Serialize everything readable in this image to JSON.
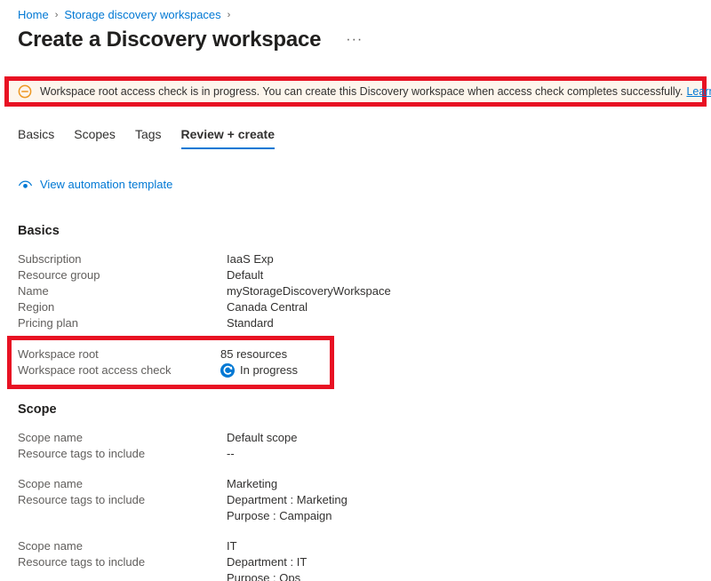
{
  "colors": {
    "accent": "#0078d4",
    "annotation_red": "#e81123",
    "warning_icon_orange": "#ed9722"
  },
  "breadcrumb": {
    "separator": "›",
    "items": [
      {
        "label": "Home"
      },
      {
        "label": "Storage discovery workspaces"
      }
    ]
  },
  "header": {
    "title": "Create a Discovery workspace",
    "more_label": "···"
  },
  "banner": {
    "text": "Workspace root access check is in progress. You can create this Discovery workspace when access check completes successfully.",
    "link_label": "Learn more"
  },
  "tabs": [
    {
      "label": "Basics",
      "active": false
    },
    {
      "label": "Scopes",
      "active": false
    },
    {
      "label": "Tags",
      "active": false
    },
    {
      "label": "Review + create",
      "active": true
    }
  ],
  "automation_link": {
    "label": "View automation template"
  },
  "basics": {
    "title": "Basics",
    "rows": [
      {
        "label": "Subscription",
        "lines": [
          "IaaS Exp"
        ]
      },
      {
        "label": "Resource group",
        "lines": [
          "Default"
        ]
      },
      {
        "label": "Name",
        "lines": [
          "myStorageDiscoveryWorkspace"
        ]
      },
      {
        "label": "Region",
        "lines": [
          "Canada Central"
        ]
      },
      {
        "label": "Pricing plan",
        "lines": [
          "Standard"
        ]
      }
    ]
  },
  "highlighted": {
    "rows": [
      {
        "label": "Workspace root",
        "lines": [
          "85 resources"
        ]
      },
      {
        "label": "Workspace root access check",
        "lines": [
          "In progress"
        ],
        "icon": "sync-icon"
      }
    ]
  },
  "scope": {
    "title": "Scope",
    "groups": [
      {
        "rows": [
          {
            "label": "Scope name",
            "lines": [
              "Default scope"
            ]
          },
          {
            "label": "Resource tags to include",
            "lines": [
              "--"
            ]
          }
        ]
      },
      {
        "rows": [
          {
            "label": "Scope name",
            "lines": [
              "Marketing"
            ]
          },
          {
            "label": "Resource tags to include",
            "lines": [
              "Department : Marketing",
              "Purpose : Campaign"
            ]
          }
        ]
      },
      {
        "rows": [
          {
            "label": "Scope name",
            "lines": [
              "IT"
            ]
          },
          {
            "label": "Resource tags to include",
            "lines": [
              "Department : IT",
              "Purpose : Ops"
            ]
          }
        ]
      }
    ]
  }
}
